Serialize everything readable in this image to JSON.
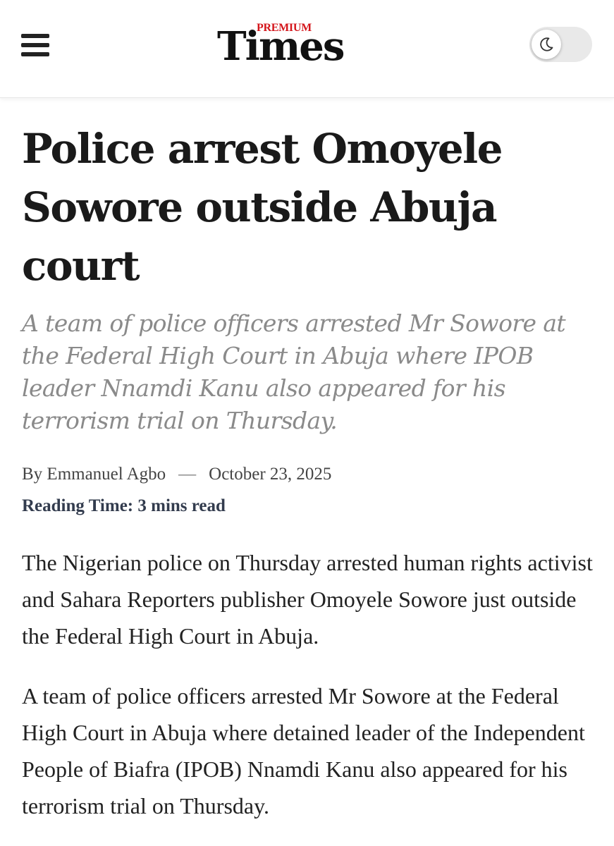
{
  "header": {
    "menu_icon": "hamburger-menu-icon",
    "logo": {
      "premium": "PREMIUM",
      "times": "Times"
    },
    "theme_toggle_icon": "moon-icon",
    "brand_red": "#d4151b"
  },
  "article": {
    "headline": "Police arrest Omoyele Sowore outside Abuja court",
    "standfirst": "A team of police officers arrested Mr Sowore at the Federal High Court in Abuja where IPOB leader Nnamdi Kanu also appeared for his terrorism trial on Thursday.",
    "byline": {
      "by": "By Emmanuel Agbo",
      "separator": "—",
      "date": "October 23, 2025"
    },
    "reading_time": "Reading Time: 3 mins read",
    "paragraphs": [
      "The Nigerian police on Thursday arrested human rights activist and Sahara Reporters publisher Omoyele Sowore just outside the Federal High Court in Abuja.",
      "A team of police officers arrested Mr Sowore at the Federal High Court in Abuja where detained leader of the Independent People of Biafra (IPOB) Nnamdi Kanu also appeared for his terrorism trial on Thursday."
    ]
  }
}
